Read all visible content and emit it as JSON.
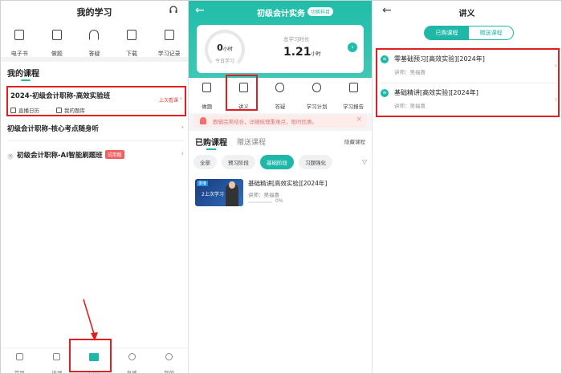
{
  "p1": {
    "title": "我的学习",
    "quick": [
      {
        "label": "电子书",
        "icon": "phone-icon"
      },
      {
        "label": "做题",
        "icon": "clipboard-icon"
      },
      {
        "label": "答疑",
        "icon": "headphones-icon"
      },
      {
        "label": "下载",
        "icon": "download-icon"
      },
      {
        "label": "学习记录",
        "icon": "calendar-icon"
      }
    ],
    "section_title": "我的课程",
    "course1": {
      "name": "2024-初级会计职称-高效实验班",
      "last_seen": "上次看课",
      "links": [
        "直播日历",
        "我的题库"
      ]
    },
    "course2": "初级会计职称-核心考点随身听",
    "course3": {
      "name": "初级会计职称-AI智能刷题班",
      "badge": "试用版"
    },
    "tabs": [
      {
        "label": "首页"
      },
      {
        "label": "选课"
      },
      {
        "label": "学习"
      },
      {
        "label": "直播"
      },
      {
        "label": "我的"
      }
    ]
  },
  "p2": {
    "title": "初级会计实务",
    "subject_tag": "切换科目",
    "today_value": "0",
    "today_unit": "小时",
    "today_label": "今日学习",
    "total_label": "总学习时长",
    "total_value": "1.21",
    "total_unit": "小时",
    "functions": [
      {
        "label": "做题"
      },
      {
        "label": "讲义"
      },
      {
        "label": "答疑"
      },
      {
        "label": "学习计划"
      },
      {
        "label": "学习报告"
      }
    ],
    "notice": "教辅完美结合，详细梳理重难点，限时优惠。",
    "tab_purchased": "已购课程",
    "tab_gift": "赠送课程",
    "hide_label": "隐藏课程",
    "chips": [
      "全部",
      "预习阶段",
      "基础阶段",
      "习题强化"
    ],
    "lesson": {
      "thumb_tag": "录播",
      "thumb_caption": "2上次学习",
      "title": "基础精讲[高效实验][2024年]",
      "teacher": "讲师：吴福喜",
      "progress": 0,
      "progress_label": "0%"
    }
  },
  "p3": {
    "title": "讲义",
    "seg_purchased": "已购课程",
    "seg_gift": "赠送课程",
    "items": [
      {
        "title": "零基础预习[高效实验][2024年]",
        "teacher": "讲师：吴福喜"
      },
      {
        "title": "基础精讲[高效实验][2024年]",
        "teacher": "讲师：吴福喜"
      }
    ]
  },
  "colors": {
    "accent": "#1fb8a8",
    "highlight": "#e02020"
  }
}
